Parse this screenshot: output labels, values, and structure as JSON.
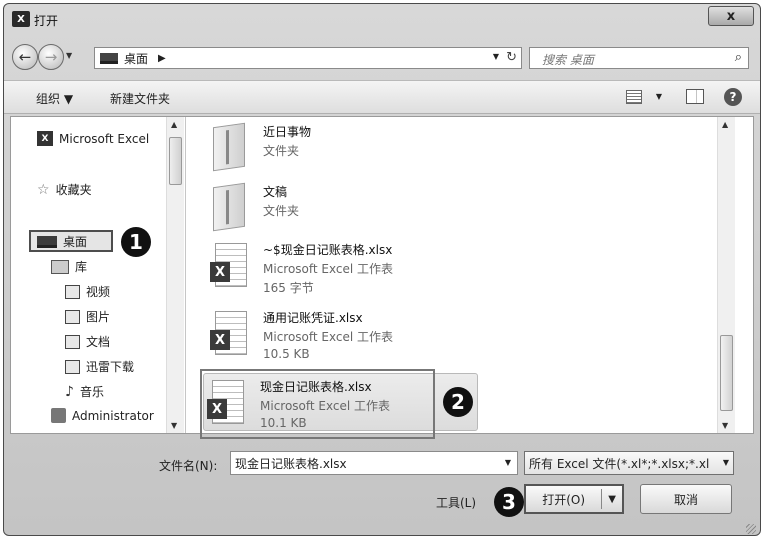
{
  "window": {
    "title": "打开",
    "close_label": "x",
    "app_icon_text": "X"
  },
  "nav": {
    "address_path": "桌面",
    "search_placeholder": "搜索 桌面"
  },
  "toolbar": {
    "organize": "组织 ▼",
    "new_folder": "新建文件夹"
  },
  "sidebar": {
    "items": [
      {
        "label": "Microsoft Excel",
        "icon": "excel-icon"
      },
      {
        "label": "收藏夹",
        "icon": "star-icon"
      },
      {
        "label": "桌面",
        "icon": "desktop-icon"
      },
      {
        "label": "库",
        "icon": "library-icon"
      },
      {
        "label": "视频",
        "icon": "video-icon"
      },
      {
        "label": "图片",
        "icon": "picture-icon"
      },
      {
        "label": "文档",
        "icon": "document-icon"
      },
      {
        "label": "迅雷下载",
        "icon": "download-icon"
      },
      {
        "label": "音乐",
        "icon": "music-icon"
      },
      {
        "label": "Administrator",
        "icon": "user-icon"
      }
    ]
  },
  "files": [
    {
      "name": "近日事物",
      "type": "文件夹",
      "size": "",
      "kind": "folder"
    },
    {
      "name": "文稿",
      "type": "文件夹",
      "size": "",
      "kind": "folder"
    },
    {
      "name": "~$现金日记账表格.xlsx",
      "type": "Microsoft Excel 工作表",
      "size": "165 字节",
      "kind": "xlsx"
    },
    {
      "name": "通用记账凭证.xlsx",
      "type": "Microsoft Excel 工作表",
      "size": "10.5 KB",
      "kind": "xlsx"
    },
    {
      "name": "现金日记账表格.xlsx",
      "type": "Microsoft Excel 工作表",
      "size": "10.1 KB",
      "kind": "xlsx",
      "selected": true
    }
  ],
  "bottom": {
    "filename_label": "文件名(N):",
    "filename_value": "现金日记账表格.xlsx",
    "filetype_value": "所有 Excel 文件(*.xl*;*.xlsx;*.xl",
    "tools_label": "工具(L)",
    "open_label": "打开(O)",
    "cancel_label": "取消"
  },
  "markers": {
    "m1": "1",
    "m2": "2",
    "m3": "3"
  }
}
